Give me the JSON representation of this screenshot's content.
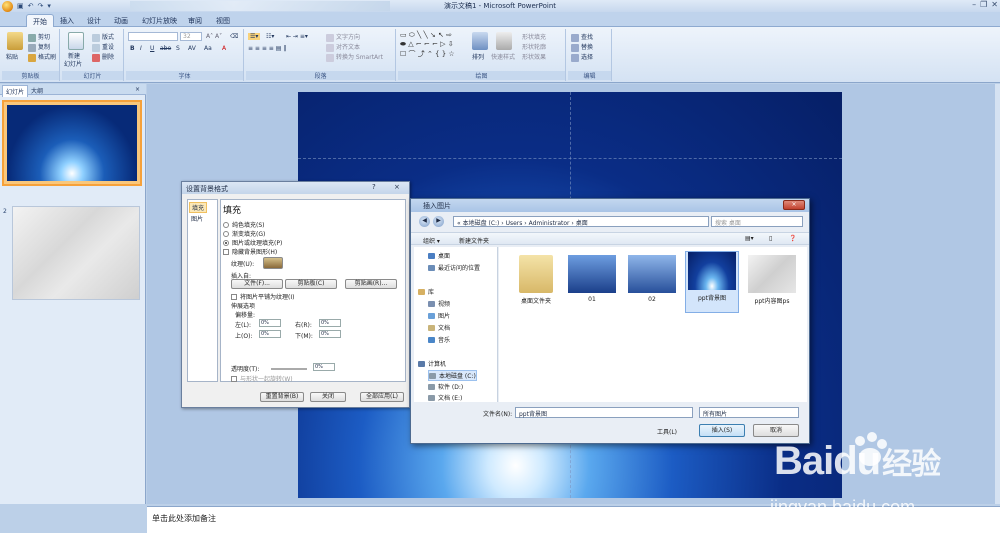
{
  "window": {
    "title": "演示文稿1 - Microsoft PowerPoint"
  },
  "tabs": [
    "开始",
    "插入",
    "设计",
    "动画",
    "幻灯片放映",
    "审阅",
    "视图"
  ],
  "ribbon": {
    "clipboard": {
      "paste": "粘贴",
      "cut": "剪切",
      "copy": "复制",
      "format_painter": "格式刷",
      "label": "剪贴板"
    },
    "slides": {
      "new_slide_1": "新建",
      "new_slide_2": "幻灯片",
      "layout": "版式",
      "reset": "重设",
      "delete": "删除",
      "label": "幻灯片"
    },
    "font": {
      "size": "32",
      "bold": "B",
      "italic": "I",
      "underline": "U",
      "strike": "abe",
      "shadow": "S",
      "spacing": "AV",
      "case": "Aa",
      "color": "A",
      "label": "字体"
    },
    "paragraph": {
      "text_direction": "文字方向",
      "align_text": "对齐文本",
      "smartart": "转换为 SmartArt",
      "label": "段落"
    },
    "drawing": {
      "arrange": "排列",
      "quick_styles": "快速样式",
      "shape_fill": "形状填充",
      "shape_outline": "形状轮廓",
      "shape_effects": "形状效果",
      "label": "绘图"
    },
    "editing": {
      "find": "查找",
      "replace": "替换",
      "select": "选择",
      "label": "编辑"
    }
  },
  "left_pane": {
    "tab_slides": "幻灯片",
    "tab_outline": "大纲",
    "close": "×",
    "slide1_num": "1",
    "slide2_num": "2"
  },
  "notes": {
    "placeholder": "单击此处添加备注"
  },
  "bg_dialog": {
    "title": "设置背景格式",
    "help": "?",
    "close": "×",
    "side_fill": "填充",
    "side_picture": "图片",
    "heading": "填充",
    "opt_solid": "纯色填充(S)",
    "opt_gradient": "渐变填充(G)",
    "opt_picture": "图片或纹理填充(P)",
    "opt_hide": "隐藏背景图形(H)",
    "texture": "纹理(U):",
    "insert_from": "插入自:",
    "btn_file": "文件(F)...",
    "btn_clipboard": "剪贴板(C)",
    "btn_clipart": "剪贴画(R)...",
    "tile": "将图片平铺为纹理(I)",
    "stretch": "伸展选项",
    "offset": "偏移量:",
    "left": "左(L):",
    "right": "右(R):",
    "top": "上(O):",
    "bottom": "下(M):",
    "val_left": "0%",
    "val_right": "0%",
    "val_top": "0%",
    "val_bottom": "0%",
    "transparency": "透明度(T):",
    "val_transparency": "0%",
    "rotate": "与形状一起旋转(W)",
    "btn_reset": "重置背景(B)",
    "btn_close": "关闭",
    "btn_apply_all": "全部应用(L)"
  },
  "insert_dialog": {
    "title": "插入图片",
    "close": "×",
    "path": "«  本地磁盘 (C:)  ›  Users  ›  Administrator  ›  桌面",
    "search_placeholder": "搜索 桌面",
    "organize": "组织 ▾",
    "new_folder": "新建文件夹",
    "tree": [
      "桌面",
      "最近访问的位置",
      "库",
      "视频",
      "图片",
      "文档",
      "音乐",
      "计算机",
      "本地磁盘 (C:)",
      "软件 (D:)",
      "文档 (E:)"
    ],
    "files": [
      "桌面文件夹",
      "01",
      "02",
      "ppt背景图",
      "ppt内容图ps"
    ],
    "filename_label": "文件名(N):",
    "filename_value": "ppt背景图",
    "filetype": "所有图片",
    "tools": "工具(L)",
    "insert": "插入(S)",
    "cancel": "取消"
  },
  "watermark": {
    "brand": "Bai",
    "brand2": "du",
    "cn": "经验",
    "url": "jingyan.baidu.com"
  }
}
